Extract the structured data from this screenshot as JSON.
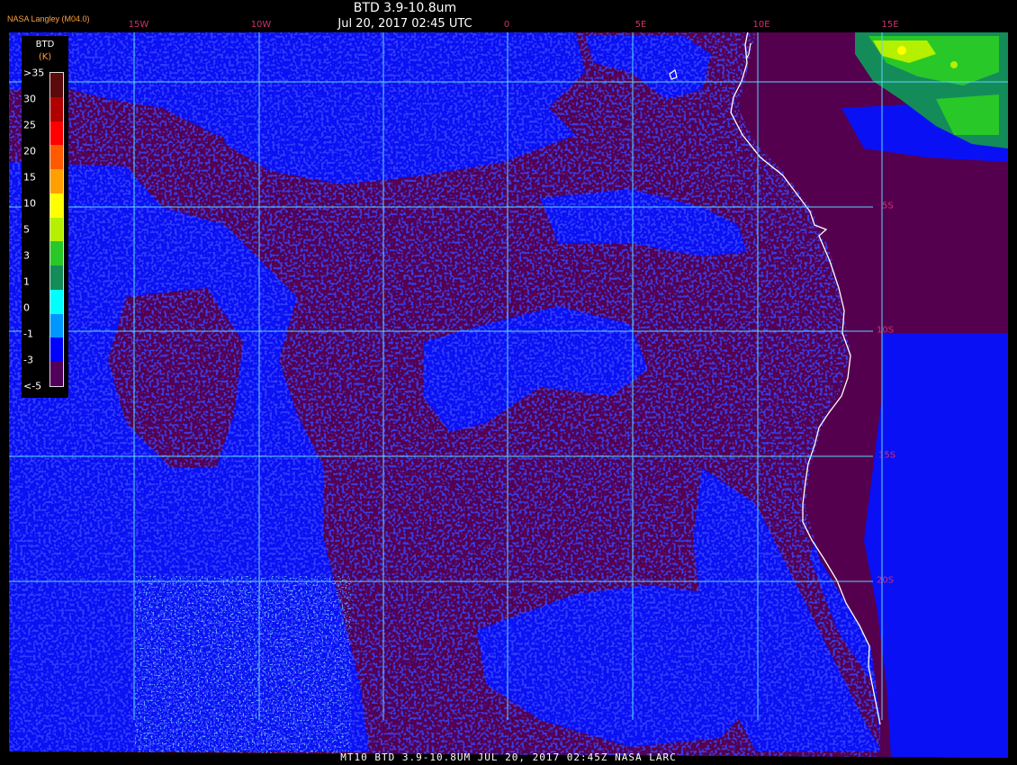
{
  "header": {
    "title": "BTD 3.9-10.8um",
    "subtitle": "Jul 20, 2017 02:45 UTC",
    "org": "NASA Langley (M04.0)"
  },
  "footer": {
    "caption": "MT10  BTD 3.9-10.8UM   JUL 20, 2017 02:45Z  NASA LARC"
  },
  "legend": {
    "title_line1": "BTD",
    "title_line2": "(K)",
    "ticks": [
      ">35",
      "30",
      "25",
      "20",
      "15",
      "10",
      "5",
      "3",
      "1",
      "0",
      "-1",
      "-3",
      "<-5"
    ],
    "colors": [
      "#5a0a0a",
      "#b00000",
      "#ff0000",
      "#ff5a00",
      "#ffa000",
      "#ffff00",
      "#b4f000",
      "#28c828",
      "#148c5a",
      "#00ffff",
      "#0096ff",
      "#0000ff",
      "#50005a"
    ]
  },
  "map": {
    "lon_labels": [
      "15W",
      "10W",
      "0",
      "5E",
      "10E",
      "15E"
    ],
    "lat_labels": [
      "5S",
      "10S",
      "15S",
      "20S"
    ],
    "colors": {
      "clear": "#55004f",
      "cloud": "#0a10f4",
      "cloud_edge": "#1a5cff",
      "grid": "#5cd6ff",
      "coast": "#ffffff",
      "deep": "#28c828"
    }
  }
}
